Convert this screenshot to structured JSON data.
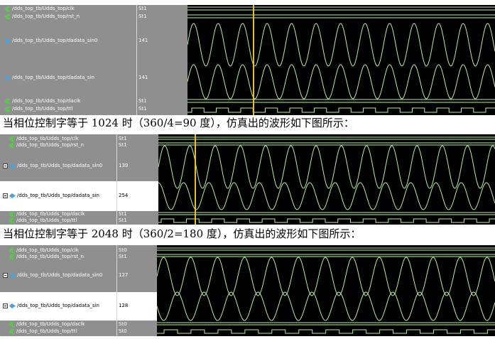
{
  "caption_1": "当相位控制字等于 1024 时（360/4=90 度），仿真出的波形如下图所示：",
  "caption_2": "当相位控制字等于 2048 时（360/2=180 度），仿真出的波形如下图所示：",
  "colors": {
    "wave": "#b8f09a",
    "panel": "#8f8f8f",
    "cursor": "#e8c020",
    "background": "#000000"
  },
  "icons": {
    "logic": "signal-logic-icon",
    "analog": "signal-analog-icon",
    "expand": "expand-toggle-icon"
  },
  "panels": [
    {
      "phase_word": null,
      "signals": [
        {
          "name": "/dds_top_tb/Udds_top/clk",
          "value": "St1"
        },
        {
          "name": "/dds_top_tb/Udds_top/rst_n",
          "value": "St1"
        },
        {
          "name": "/dds_top_tb/Udds_top/dadata_sin0",
          "value": "141"
        },
        {
          "name": "/dds_top_tb/Udds_top/dadata_sin",
          "value": "141"
        },
        {
          "name": "/dds_top_tb/Udds_top/daclk",
          "value": "St1"
        },
        {
          "name": "/dds_top_tb/Udds_top/ttl",
          "value": "St1"
        }
      ]
    },
    {
      "phase_word": 1024,
      "signals": [
        {
          "name": "/dds_top_tb/Udds_top/clk",
          "value": "St1"
        },
        {
          "name": "/dds_top_tb/Udds_top/rst_n",
          "value": "St1"
        },
        {
          "name": "/dds_top_tb/Udds_top/dadata_sin0",
          "value": "139"
        },
        {
          "name": "/dds_top_tb/Udds_top/dadata_sin",
          "value": "254"
        },
        {
          "name": "/dds_top_tb/Udds_top/daclk",
          "value": "St1"
        },
        {
          "name": "/dds_top_tb/Udds_top/ttl",
          "value": "St1"
        }
      ]
    },
    {
      "phase_word": 2048,
      "signals": [
        {
          "name": "/dds_top_tb/Udds_top/clk",
          "value": "St0"
        },
        {
          "name": "/dds_top_tb/Udds_top/rst_n",
          "value": "St1"
        },
        {
          "name": "/dds_top_tb/Udds_top/dadata_sin0",
          "value": "127"
        },
        {
          "name": "/dds_top_tb/Udds_top/dadata_sin",
          "value": "128"
        },
        {
          "name": "/dds_top_tb/Udds_top/daclk",
          "value": "St0"
        },
        {
          "name": "/dds_top_tb/Udds_top/ttl",
          "value": "St0"
        }
      ]
    }
  ]
}
